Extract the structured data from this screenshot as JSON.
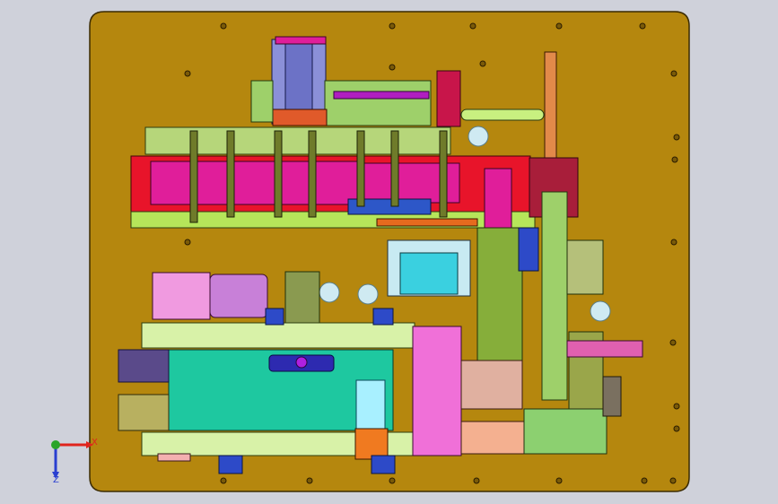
{
  "view": {
    "background": "#cfd1da",
    "plate_color": "#b5870e",
    "plate_edge": "#3a2a00"
  },
  "triad": {
    "x_label": "X",
    "y_label": "Y",
    "z_label": "Z",
    "x_color": "#e0241c",
    "y_color": "#2aa52a",
    "z_color": "#2a3fd0"
  },
  "icons": {
    "origin": "origin-sphere-icon"
  }
}
